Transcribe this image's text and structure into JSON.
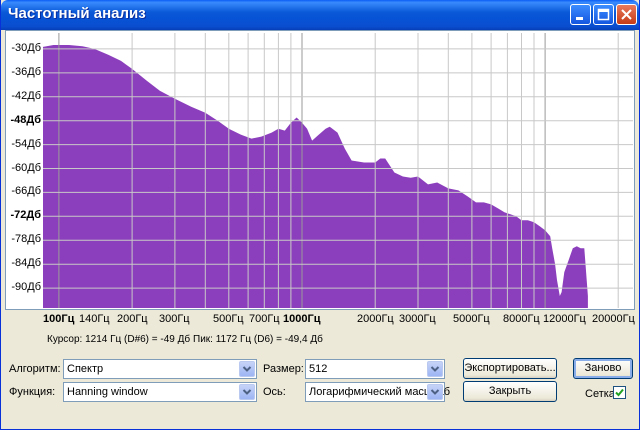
{
  "window": {
    "title": "Частотный анализ"
  },
  "chart_data": {
    "type": "area",
    "x_scale": "log",
    "grid": true,
    "fill_color": "#8c3fbc",
    "y_ticks": [
      "-30Дб",
      "-36Дб",
      "-42Дб",
      "-48Дб",
      "-54Дб",
      "-60Дб",
      "-66Дб",
      "-72Дб",
      "-78Дб",
      "-84Дб",
      "-90Дб"
    ],
    "y_bold": [
      "-48Дб",
      "-72Дб"
    ],
    "x_ticks": [
      {
        "label": "100Гц",
        "bold": true
      },
      {
        "label": "140Гц",
        "bold": false
      },
      {
        "label": "200Гц",
        "bold": false
      },
      {
        "label": "300Гц",
        "bold": false
      },
      {
        "label": "500Гц",
        "bold": false
      },
      {
        "label": "700Гц",
        "bold": false
      },
      {
        "label": "1000Гц",
        "bold": true
      },
      {
        "label": "2000Гц",
        "bold": false
      },
      {
        "label": "3000Гц",
        "bold": false
      },
      {
        "label": "5000Гц",
        "bold": false
      },
      {
        "label": "8000Гц",
        "bold": false
      },
      {
        "label": "12000Гц",
        "bold": false
      },
      {
        "label": "20000Гц",
        "bold": false
      }
    ],
    "series": [
      {
        "x": [
          86,
          95,
          110,
          125,
          140,
          160,
          180,
          200,
          230,
          260,
          300,
          350,
          400,
          450,
          500,
          560,
          620,
          680,
          750,
          800,
          850,
          900,
          950,
          1000,
          1050,
          1100,
          1172,
          1250,
          1300,
          1400,
          1500,
          1600,
          1800,
          2000,
          2100,
          2200,
          2400,
          2600,
          2800,
          3000,
          3300,
          3600,
          4000,
          4400,
          4800,
          5200,
          5600,
          6000,
          6400,
          6800,
          7200,
          7600,
          8000,
          8500,
          9000,
          9500,
          10000,
          10500,
          10700,
          11000,
          11200,
          11500,
          11700,
          12000,
          12500,
          13000,
          13500,
          14000,
          14500,
          15000
        ],
        "y": [
          -29.5,
          -29,
          -29,
          -29.3,
          -30,
          -31.5,
          -33,
          -35,
          -38,
          -40.5,
          -42.5,
          -44.5,
          -46,
          -48,
          -50,
          -51.5,
          -52.5,
          -52,
          -51,
          -50,
          -50.5,
          -48.5,
          -47.2,
          -48.5,
          -50,
          -53,
          -51.5,
          -50,
          -49.5,
          -51,
          -55,
          -58,
          -58.5,
          -58.5,
          -57.5,
          -57.5,
          -61,
          -62,
          -62.3,
          -62,
          -64,
          -63.5,
          -65,
          -65.5,
          -67,
          -68.5,
          -68.5,
          -69,
          -70,
          -71,
          -71.5,
          -72,
          -73,
          -73,
          -73.5,
          -74.5,
          -75.5,
          -77,
          -80,
          -84,
          -88,
          -92,
          -91,
          -86,
          -83,
          -80,
          -79.5,
          -80,
          -80,
          -92
        ]
      }
    ]
  },
  "status": {
    "cursor": "Курсор: 1214 Гц (D#6) = -49 Дб",
    "peak": "Пик: 1172 Гц (D6) = -49,4 Дб"
  },
  "controls": {
    "algorithm_label": "Алгоритм:",
    "algorithm_value": "Спектр",
    "function_label": "Функция:",
    "function_value": "Hanning window",
    "size_label": "Размер:",
    "size_value": "512",
    "axis_label": "Ось:",
    "axis_value": "Логарифмический масштаб",
    "export_button": "Экспортировать...",
    "replot_button": "Заново",
    "close_button": "Закрыть",
    "grid_label": "Сетка",
    "grid_checked": true
  }
}
